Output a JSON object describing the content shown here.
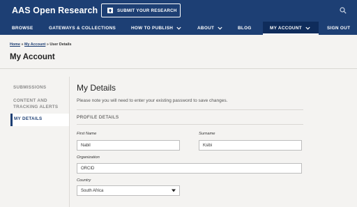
{
  "header": {
    "brand": "AAS Open Research",
    "submit_label": "SUBMIT YOUR RESEARCH"
  },
  "nav": {
    "items": [
      {
        "label": "BROWSE"
      },
      {
        "label": "GATEWAYS & COLLECTIONS"
      },
      {
        "label": "HOW TO PUBLISH"
      },
      {
        "label": "ABOUT"
      },
      {
        "label": "BLOG"
      },
      {
        "label": "MY ACCOUNT"
      },
      {
        "label": "SIGN OUT"
      }
    ]
  },
  "breadcrumb": {
    "home": "Home",
    "sep": "»",
    "account": "My Account",
    "current": "User Details"
  },
  "page_title": "My Account",
  "sidebar": {
    "items": [
      {
        "label": "SUBMISSIONS"
      },
      {
        "label": "CONTENT AND"
      },
      {
        "label": "TRACKING ALERTS"
      },
      {
        "label": "MY DETAILS"
      }
    ]
  },
  "main": {
    "title": "My Details",
    "note": "Please note you will need to enter your existing password to save changes.",
    "section": "PROFILE DETAILS",
    "fields": {
      "first_name": {
        "label": "First Name",
        "value": "Nabil"
      },
      "surname": {
        "label": "Surname",
        "value": "Ksibi"
      },
      "organization": {
        "label": "Organization",
        "value": "ORCID"
      },
      "country": {
        "label": "Country",
        "value": "South Africa"
      }
    }
  },
  "colors": {
    "brand_blue": "#1d3f74",
    "active_nav": "#0f2c5b",
    "page_bg": "#f4f3f1"
  }
}
